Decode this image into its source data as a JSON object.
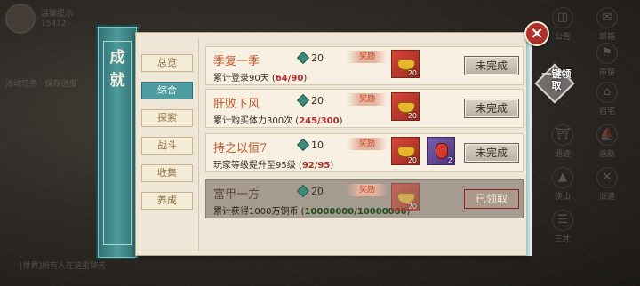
{
  "background": {
    "top_left_line1": "温馨提示",
    "top_left_line2": "15472",
    "left_text": "活动任务   保存进度",
    "bottom_text": "[世界]所有人在这里聊天"
  },
  "right_menu": {
    "items": [
      {
        "label": "公告",
        "icon": "scroll-icon"
      },
      {
        "label": "邮箱",
        "icon": "mail-icon"
      },
      {
        "label": "声望",
        "icon": "banner-icon"
      },
      {
        "label": "自宅",
        "icon": "house-icon"
      },
      {
        "label": "遗迹",
        "icon": "gate-icon"
      },
      {
        "label": "画舫",
        "icon": "boat-icon"
      },
      {
        "label": "侠山",
        "icon": "mountain-icon"
      },
      {
        "label": "派遣",
        "icon": "cross-icon"
      },
      {
        "label": "三才",
        "icon": "tri-icon"
      }
    ]
  },
  "close_label": "×",
  "claim_all_label": "一键领取",
  "title_chars": [
    "成",
    "就"
  ],
  "tabs": [
    {
      "label": "总览",
      "active": false
    },
    {
      "label": "综合",
      "active": true
    },
    {
      "label": "探索",
      "active": false
    },
    {
      "label": "战斗",
      "active": false
    },
    {
      "label": "收集",
      "active": false
    },
    {
      "label": "养成",
      "active": false
    }
  ],
  "achievements": [
    {
      "title": "季复一季",
      "points": "20",
      "badge": "奖励",
      "desc": "累计登录90天",
      "progress": "64/90",
      "rewards": [
        {
          "type": "gold-ingot",
          "count": "20"
        }
      ],
      "status": "未完成",
      "claimed": false
    },
    {
      "title": "肝败下风",
      "points": "20",
      "badge": "奖励",
      "desc": "累计购买体力300次",
      "progress": "245/300",
      "rewards": [
        {
          "type": "gold-ingot",
          "count": "20"
        }
      ],
      "status": "未完成",
      "claimed": false
    },
    {
      "title": "持之以恒7",
      "points": "10",
      "badge": "奖励",
      "desc": "玩家等级提升至95级",
      "progress": "92/95",
      "rewards": [
        {
          "type": "gold-ingot",
          "count": "20"
        },
        {
          "type": "red-pouch",
          "count": "2"
        }
      ],
      "status": "未完成",
      "claimed": false
    },
    {
      "title": "富甲一方",
      "points": "20",
      "badge": "奖励",
      "desc": "累计获得1000万铜币",
      "progress": "10000000/10000000",
      "rewards": [
        {
          "type": "gold-ingot",
          "count": "20"
        }
      ],
      "status": "已领取",
      "claimed": true
    }
  ]
}
